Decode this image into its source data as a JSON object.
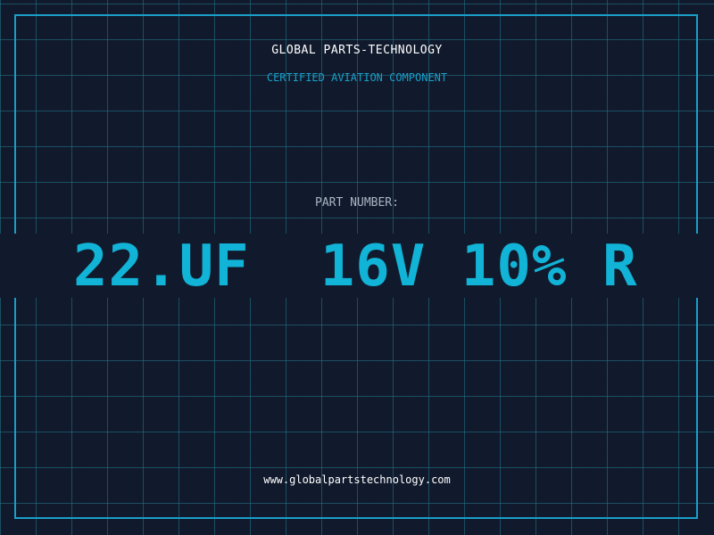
{
  "header": {
    "company": "GLOBAL PARTS-TECHNOLOGY",
    "subtitle": "CERTIFIED AVIATION COMPONENT"
  },
  "part": {
    "label": "PART NUMBER:",
    "number": "22.UF  16V 10% R"
  },
  "footer": {
    "website": "www.globalpartstechnology.com"
  },
  "colors": {
    "background": "#111a2c",
    "accent": "#1a9ec8",
    "part_number": "#11b3d6",
    "grid": "#22788c"
  }
}
